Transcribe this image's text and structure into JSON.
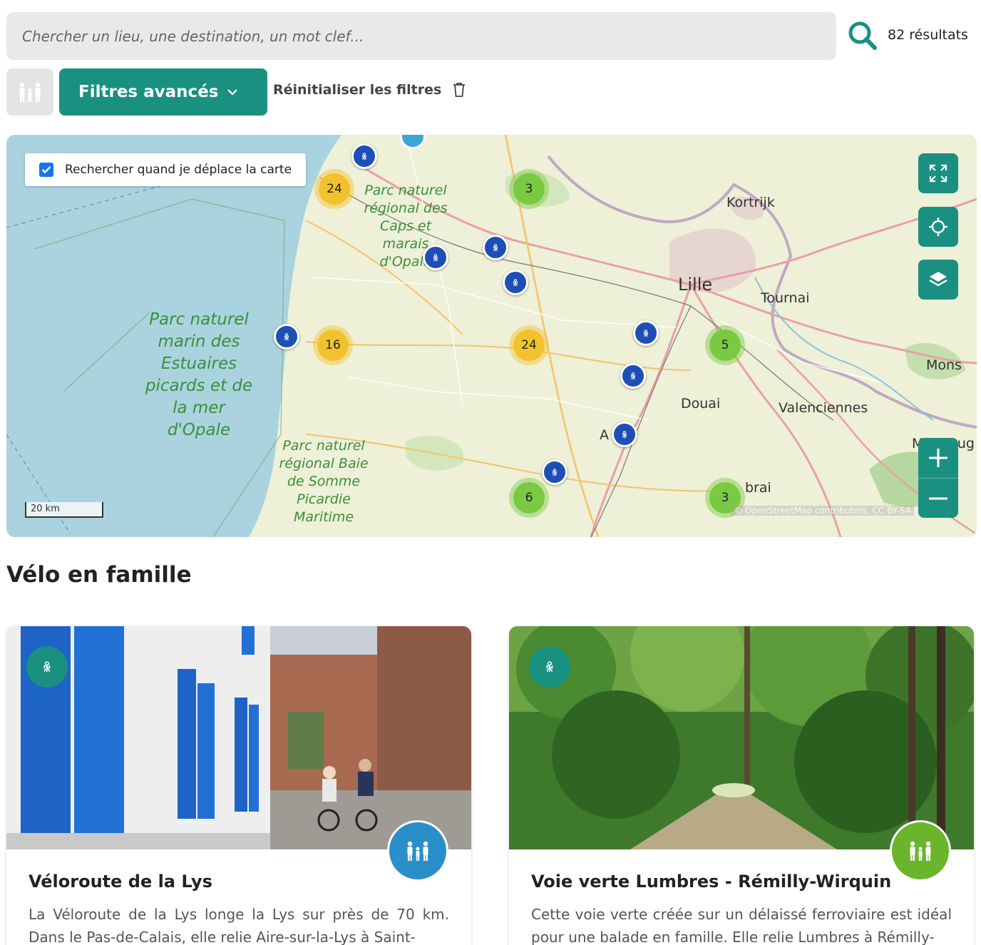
{
  "search": {
    "placeholder": "Chercher un lieu, une destination, un mot clef...",
    "value": "",
    "results_count": "82 résultats",
    "icon": "search-icon"
  },
  "filters": {
    "category_icon": "family-icon",
    "advanced_label": "Filtres avancés",
    "reset_label": "Réinitialiser les filtres",
    "reset_icon": "trash-icon"
  },
  "map": {
    "search_on_move_label": "Rechercher quand je déplace la carte",
    "search_on_move_checked": true,
    "scale_label": "20 km",
    "attribution": "© OpenStreetMap contributors, CC BY-SA",
    "controls": [
      "fullscreen-icon",
      "locate-icon",
      "layers-icon",
      "zoom-in-icon",
      "zoom-out-icon"
    ],
    "labels": {
      "kortrijk": "Kortrijk",
      "lille": "Lille",
      "tournai": "Tournai",
      "mons": "Mons",
      "douai": "Douai",
      "valenciennes": "Valenciennes",
      "cambrai": "brai",
      "arras": "A",
      "maubeuge": "Maubeug",
      "park_caps": "Parc naturel régional des Caps et marais d'Opale",
      "park_marin": "Parc naturel marin des Estuaires picards et de la mer d'Opale",
      "park_somme": "Parc naturel régional Baie de Somme Picardie Maritime"
    },
    "clusters": {
      "c1": "24",
      "c2": "3",
      "c3": "16",
      "c4": "24",
      "c5": "5",
      "c6": "6",
      "c7": "3"
    },
    "colors": {
      "cluster_yellow": "#f2c12e",
      "cluster_green": "#7ac943",
      "marker_blue": "#1e4fb5",
      "accent": "#1a9080"
    }
  },
  "section": {
    "title": "Vélo en famille"
  },
  "cards": [
    {
      "title": "Véloroute de la Lys",
      "text": "La Véloroute de la Lys longe la Lys sur près de 70 km. Dans le Pas-de-Calais, elle relie Aire-sur-la-Lys à Saint-",
      "badge_color": "#2a8fc9"
    },
    {
      "title": "Voie verte Lumbres - Rémilly-Wirquin",
      "text": "Cette voie verte créée sur un délaissé ferroviaire est idéal pour une balade en famille. Elle relie Lumbres à Rémilly-",
      "badge_color": "#6bb52d"
    }
  ]
}
